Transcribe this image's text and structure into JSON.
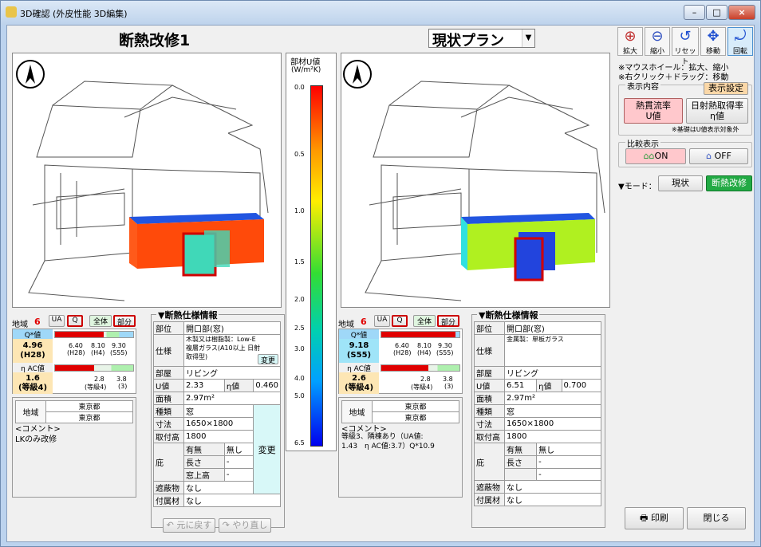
{
  "window": {
    "title": "3D確認 (外皮性能 3D編集)",
    "min": "–",
    "max": "□",
    "close": "×"
  },
  "left": {
    "title": "断熱改修1",
    "region_label": "地域",
    "region_no": "6",
    "tabs": {
      "ua": "UA",
      "q": "Q",
      "all": "全体",
      "part": "部分"
    },
    "q_label": "Q*値",
    "q_value": "4.96",
    "q_grade": "(H28)",
    "q_scale": [
      "6.40\n(H28)",
      "8.10\n(H4)",
      "9.30\n(S55)"
    ],
    "q_scale_a": "6.40",
    "q_scale_b": "8.10",
    "q_scale_c": "9.30",
    "q_scale_a2": "(H28)",
    "q_scale_b2": "(H4)",
    "q_scale_c2": "(S55)",
    "eta_label": "η AC値",
    "eta_value": "1.6",
    "eta_grade": "(等級4)",
    "eta_scale_a": "2.8",
    "eta_scale_b": "3.8",
    "eta_scale_a2": "(等級4)",
    "eta_scale_b2": "(3)",
    "q_fill": 0.62,
    "eta_fill": 0.5,
    "area_label": "地域",
    "area_v1": "東京都",
    "area_v2": "東京都",
    "comment_label": "<コメント>",
    "comment": "LKのみ改修",
    "spec": {
      "title": "▼断熱仕様情報",
      "rows": {
        "part_l": "部位",
        "part_v": "開口部(窓)",
        "spec_l": "仕様",
        "spec_v": "木製又は樹脂製：Low-E\n複層ガラス(A10以上 日射\n取得型)",
        "change": "変更",
        "room_l": "部屋",
        "room_v": "リビング",
        "u_l": "U値",
        "u_v": "2.33",
        "eta_l": "η値",
        "eta_v": "0.460",
        "area_l": "面積",
        "area_v": "2.97m²",
        "kind_l": "種類",
        "kind_v": "窓",
        "size_l": "寸法",
        "size_v": "1650×1800",
        "h_l": "取付高",
        "h_v": "1800",
        "eave_l": "庇",
        "has_l": "有無",
        "has_v": "無し",
        "len_l": "長さ",
        "len_v": "-",
        "top_l": "窓上高",
        "top_v": "-",
        "change2": "変更",
        "shade_l": "遮蔽物",
        "shade_v": "なし",
        "att_l": "付属材",
        "att_v": "なし"
      }
    },
    "undo": "元に戻す",
    "redo": "やり直し"
  },
  "scale": {
    "title": "部材U値",
    "unit": "(W/m²K)",
    "ticks": [
      "0.0",
      "0.5",
      "1.0",
      "1.5",
      "2.0",
      "2.5",
      "3.0",
      "4.0",
      "5.0",
      "6.5"
    ]
  },
  "right": {
    "plan": "現状プラン",
    "region_label": "地域",
    "region_no": "6",
    "tabs": {
      "ua": "UA",
      "q": "Q",
      "all": "全体",
      "part": "部分"
    },
    "q_label": "Q*値",
    "q_value": "9.18",
    "q_grade": "(S55)",
    "q_scale_a": "6.40",
    "q_scale_b": "8.10",
    "q_scale_c": "9.30",
    "q_scale_a2": "(H28)",
    "q_scale_b2": "(H4)",
    "q_scale_c2": "(S55)",
    "eta_label": "η AC値",
    "eta_value": "2.6",
    "eta_grade": "(等級4)",
    "eta_scale_a": "2.8",
    "eta_scale_b": "3.8",
    "eta_scale_a2": "(等級4)",
    "eta_scale_b2": "(3)",
    "q_fill": 0.95,
    "eta_fill": 0.6,
    "area_label": "地域",
    "area_v1": "東京都",
    "area_v2": "東京都",
    "comment_label": "<コメント>",
    "comment": "等級3、隣棟あり（UA値:\n1.43　η AC値:3.7）Q*10.9",
    "spec": {
      "title": "▼断熱仕様情報",
      "rows": {
        "part_l": "部位",
        "part_v": "開口部(窓)",
        "spec_l": "仕様",
        "spec_v": "金属製：単板ガラス",
        "room_l": "部屋",
        "room_v": "リビング",
        "u_l": "U値",
        "u_v": "6.51",
        "eta_l": "η値",
        "eta_v": "0.700",
        "area_l": "面積",
        "area_v": "2.97m²",
        "kind_l": "種類",
        "kind_v": "窓",
        "size_l": "寸法",
        "size_v": "1650×1800",
        "h_l": "取付高",
        "h_v": "1800",
        "eave_l": "庇",
        "has_l": "有無",
        "has_v": "無し",
        "len_l": "長さ",
        "len_v": "-",
        "top_v": "-",
        "shade_l": "遮蔽物",
        "shade_v": "なし",
        "att_l": "付属材",
        "att_v": "なし"
      }
    }
  },
  "tools": {
    "zoom_in": "拡大",
    "zoom_out": "縮小",
    "reset": "リセット",
    "move": "移動",
    "rotate": "回転"
  },
  "hint1": "※マウスホイール：拡大、縮小",
  "hint2": "※右クリック＋ドラッグ：移動",
  "display": {
    "label": "表示内容",
    "settings": "表示設定",
    "heat_a": "熱貫流率",
    "heat_b": "U値",
    "solar_a": "日射熱取得率",
    "solar_b": "η値",
    "note": "※基礎はU値表示対象外"
  },
  "compare": {
    "label": "比較表示",
    "on": "ON",
    "off": "OFF"
  },
  "mode": {
    "label": "▼モード：",
    "current": "現状",
    "renovate": "断熱改修"
  },
  "print": "印刷",
  "close": "閉じる"
}
